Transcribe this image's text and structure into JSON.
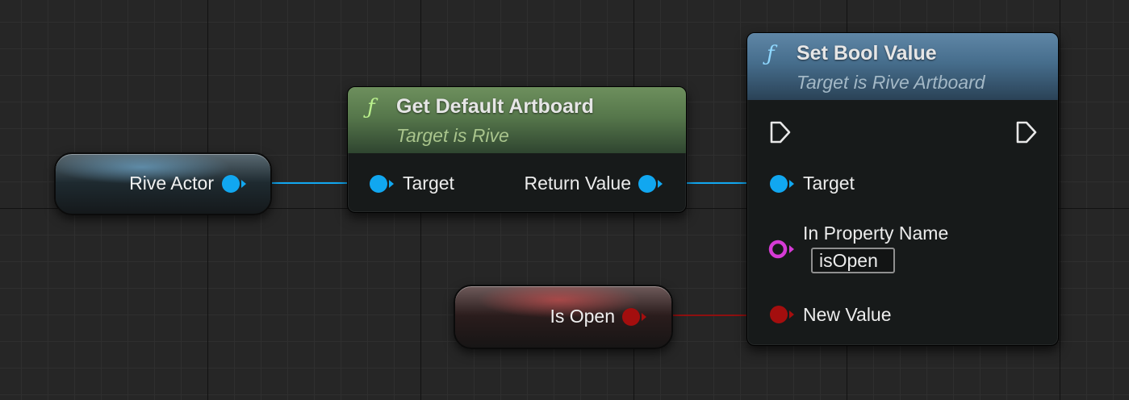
{
  "colors": {
    "object_pin": "#11a7f0",
    "name_pin": "#d63bd6",
    "bool_pin": "#a40e0e",
    "function_icon": "#b9f08c",
    "function_icon_blue": "#8fd8ff",
    "subtitle_green": "#a9c48c",
    "subtitle_blue": "#a3b8c6"
  },
  "icons": {
    "function": "function-f-icon",
    "exec": "exec-arrow-icon",
    "object_pin": "object-pin-icon",
    "name_pin": "name-pin-ring-icon",
    "bool_pin": "bool-pin-icon"
  },
  "rive_actor": {
    "label": "Rive Actor"
  },
  "is_open": {
    "label": "Is Open"
  },
  "get_artboard": {
    "icon_glyph": "ƒ",
    "title": "Get Default Artboard",
    "subtitle": "Target is Rive",
    "target_label": "Target",
    "return_label": "Return Value"
  },
  "set_bool": {
    "icon_glyph": "ƒ",
    "title": "Set Bool Value",
    "subtitle": "Target is Rive Artboard",
    "target_label": "Target",
    "property_label": "In Property Name",
    "property_value": "isOpen",
    "new_value_label": "New Value"
  }
}
